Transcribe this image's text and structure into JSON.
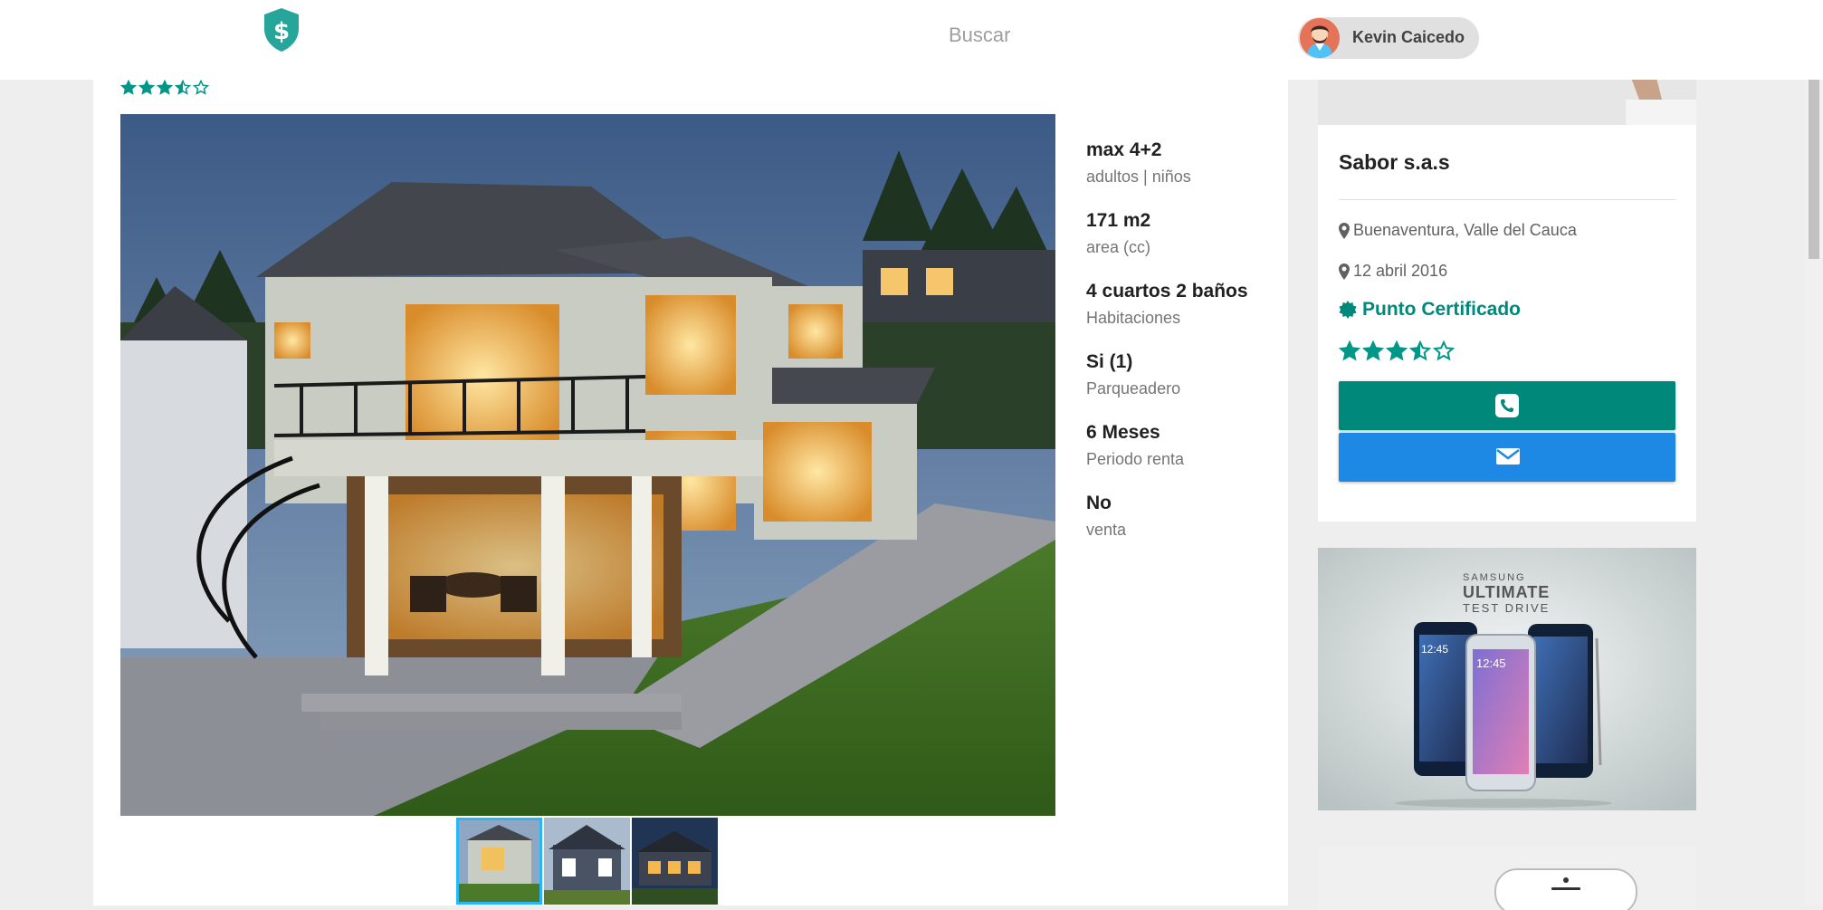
{
  "header": {
    "logo_icon": "shield-dollar-icon",
    "nav_search": "Buscar",
    "user": {
      "name": "Kevin Caicedo",
      "avatar_icon": "user-avatar-icon"
    }
  },
  "listing": {
    "rating": 3.5,
    "rating_max": 5,
    "photo_description": "house-exterior-photo",
    "thumbnails": [
      {
        "name": "thumb-1",
        "selected": true
      },
      {
        "name": "thumb-2",
        "selected": false
      },
      {
        "name": "thumb-3",
        "selected": false
      }
    ],
    "specs": [
      {
        "value": "max 4+2",
        "label": "adultos | niños"
      },
      {
        "value": "171 m2",
        "label": "area (cc)"
      },
      {
        "value": "4 cuartos 2 baños",
        "label": "Habitaciones"
      },
      {
        "value": "Si (1)",
        "label": "Parqueadero"
      },
      {
        "value": "6 Meses",
        "label": "Periodo renta"
      },
      {
        "value": "No",
        "label": "venta"
      }
    ]
  },
  "seller": {
    "name": "Sabor s.a.s",
    "location": "Buenaventura, Valle del Cauca",
    "location_icon": "map-marker-icon",
    "date": "12 abril 2016",
    "date_icon": "map-marker-icon",
    "certified_label": "Punto Certificado",
    "certified_icon": "certificate-icon",
    "rating": 3.5,
    "rating_max": 5,
    "phone_icon": "phone-icon",
    "email_icon": "envelope-icon"
  },
  "ads": {
    "samsung": {
      "brand": "SAMSUNG",
      "line1": "ULTIMATE",
      "line2": "TEST DRIVE",
      "clock_a": "12:45",
      "clock_b": "12:45"
    }
  },
  "colors": {
    "accent": "#00897b",
    "brand_teal": "#26a69a",
    "email_button": "#1e88e5",
    "star": "#009688",
    "thumb_selected": "#29b6f6"
  }
}
